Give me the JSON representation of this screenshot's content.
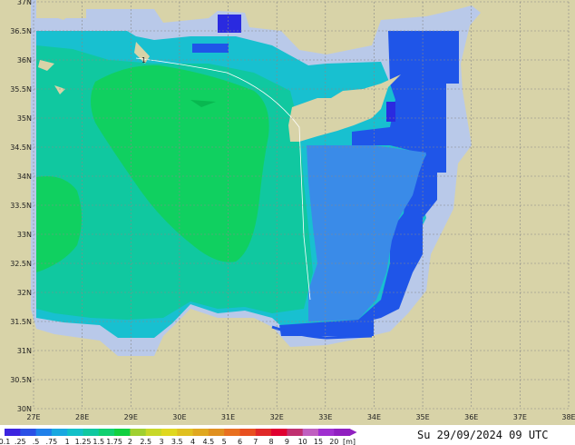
{
  "map": {
    "latitudes": [
      "37N",
      "36.5N",
      "36N",
      "35.5N",
      "35N",
      "34.5N",
      "34N",
      "33.5N",
      "33N",
      "32.5N",
      "32N",
      "31.5N",
      "31N",
      "30.5N",
      "30N"
    ],
    "longitudes": [
      "27E",
      "28E",
      "29E",
      "30E",
      "31E",
      "32E",
      "33E",
      "34E",
      "35E",
      "36E",
      "37E",
      "38E"
    ],
    "contour_label": "1",
    "colors": {
      "land": "#d8d3a8",
      "coast_halo": "#b9c9e9",
      "band_dark_blue": "#1f55e8",
      "band_blue": "#3a8be8",
      "band_cyan": "#18c0d0",
      "band_teal": "#10c8a0",
      "band_green": "#10d060",
      "band_navy": "#2a2ae0"
    }
  },
  "legend": {
    "labels": [
      "0.1",
      ".25",
      ".5",
      ".75",
      "1",
      "1.25",
      "1.5",
      "1.75",
      "2",
      "2.5",
      "3",
      "3.5",
      "4",
      "4.5",
      "5",
      "6",
      "7",
      "8",
      "9",
      "10",
      "15",
      "20"
    ],
    "unit": "[m]",
    "colors": [
      "#3c24e0",
      "#2a50e6",
      "#1f80ea",
      "#18a8e0",
      "#12c0c8",
      "#10c8a0",
      "#10d070",
      "#10d040",
      "#a0d030",
      "#c8d828",
      "#e0d820",
      "#e0c020",
      "#e0a820",
      "#e09020",
      "#e87020",
      "#e85020",
      "#e02828",
      "#e00030",
      "#c03070",
      "#c060c0",
      "#a030d0",
      "#9020c0"
    ]
  },
  "date_text": "Su 29/09/2024 09 UTC"
}
